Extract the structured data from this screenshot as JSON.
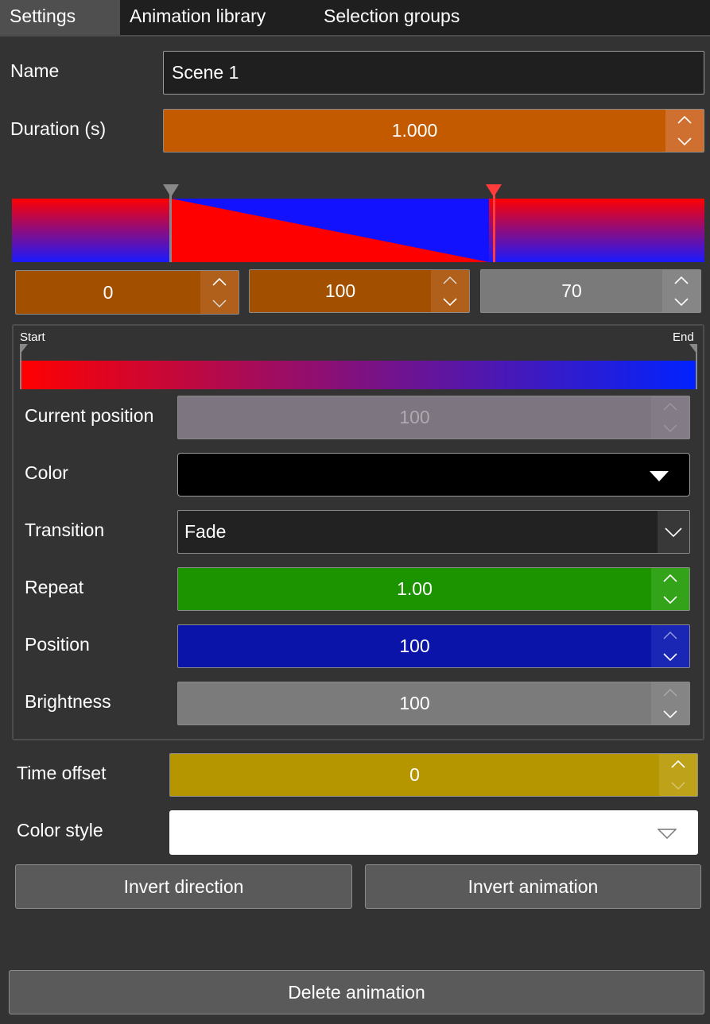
{
  "tabs": [
    {
      "label": "Settings",
      "active": true
    },
    {
      "label": "Animation library",
      "active": false
    },
    {
      "label": "Selection groups",
      "active": false
    }
  ],
  "name": {
    "label": "Name",
    "value": "Scene 1"
  },
  "duration": {
    "label": "Duration (s)",
    "value": "1.000",
    "color": "#c45a00"
  },
  "timeline": {
    "marker_start_color": "#888888",
    "marker_current_color": "#ff3b3b",
    "fields": [
      {
        "value": "0",
        "color": "#a34f00"
      },
      {
        "value": "100",
        "color": "#a34f00"
      },
      {
        "value": "70",
        "color": "#7a7a7a"
      }
    ]
  },
  "gradient": {
    "start_label": "Start",
    "end_label": "End",
    "start_color": "#ff0000",
    "end_color": "#0000ff"
  },
  "props": {
    "current_position": {
      "label": "Current position",
      "value": "100"
    },
    "color": {
      "label": "Color",
      "value_color": "#000000"
    },
    "transition": {
      "label": "Transition",
      "value": "Fade"
    },
    "repeat": {
      "label": "Repeat",
      "value": "1.00",
      "color": "#1c9400"
    },
    "position": {
      "label": "Position",
      "value": "100",
      "color": "#0a14a8"
    },
    "brightness": {
      "label": "Brightness",
      "value": "100",
      "color": "#7b7b7b"
    }
  },
  "time_offset": {
    "label": "Time offset",
    "value": "0",
    "color": "#b59600"
  },
  "color_style": {
    "label": "Color style",
    "value": ""
  },
  "buttons": {
    "invert_direction": "Invert direction",
    "invert_animation": "Invert animation",
    "delete_animation": "Delete animation"
  }
}
